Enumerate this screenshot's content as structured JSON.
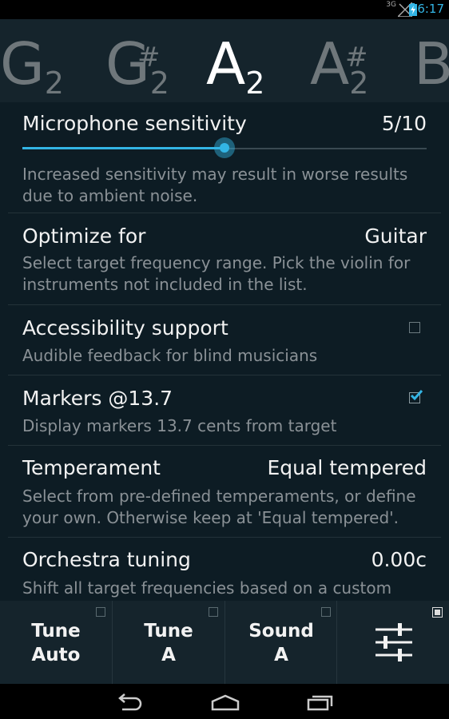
{
  "status_bar": {
    "network": "3G",
    "time": "6:17"
  },
  "notes": [
    {
      "letter": "G",
      "sharp": "",
      "octave": "2",
      "active": false
    },
    {
      "letter": "G",
      "sharp": "#",
      "octave": "2",
      "active": false
    },
    {
      "letter": "A",
      "sharp": "",
      "octave": "2",
      "active": true
    },
    {
      "letter": "A",
      "sharp": "#",
      "octave": "2",
      "active": false
    },
    {
      "letter": "B",
      "sharp": "",
      "octave": "",
      "active": false
    }
  ],
  "preferences": {
    "mic": {
      "title": "Microphone sensitivity",
      "value": "5/10",
      "level": 0.5,
      "summary_1": "Increased sensitivity may result in worse results",
      "summary_2": "due to ambient noise."
    },
    "optimize": {
      "title": "Optimize for",
      "value": "Guitar",
      "summary_1": "Select target frequency range. Pick the violin for",
      "summary_2": "instruments not included in the list."
    },
    "accessibility": {
      "title": "Accessibility support",
      "summary": "Audible feedback for blind musicians",
      "checked": false
    },
    "markers": {
      "title": "Markers @13.7",
      "summary": "Display markers 13.7 cents from target",
      "checked": true
    },
    "temperament": {
      "title": "Temperament",
      "value": "Equal tempered",
      "summary_1": "Select from pre-defined temperaments, or define",
      "summary_2": "your own. Otherwise keep at 'Equal tempered'."
    },
    "orchestra": {
      "title": "Orchestra tuning",
      "value": "0.00c",
      "summary_1": "Shift all target frequencies based on a custom"
    }
  },
  "bottom_bar": {
    "tune_auto": {
      "line1": "Tune",
      "line2": "Auto"
    },
    "tune_a": {
      "line1": "Tune",
      "line2": "A"
    },
    "sound_a": {
      "line1": "Sound",
      "line2": "A"
    },
    "settings_icon": "sliders-icon"
  },
  "colors": {
    "accent": "#33b5e5",
    "background": "#0d1c24",
    "bar": "#15242c"
  }
}
